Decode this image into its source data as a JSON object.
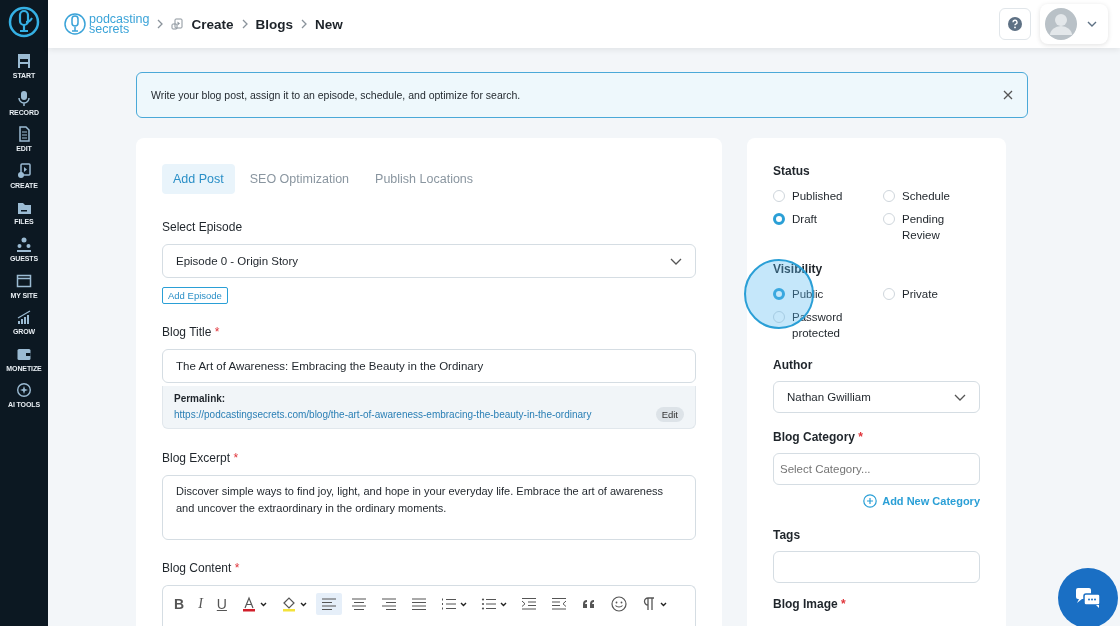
{
  "sidebar": {
    "items": [
      {
        "label": "START"
      },
      {
        "label": "RECORD"
      },
      {
        "label": "EDIT"
      },
      {
        "label": "CREATE"
      },
      {
        "label": "FILES"
      },
      {
        "label": "GUESTS"
      },
      {
        "label": "MY SITE"
      },
      {
        "label": "GROW"
      },
      {
        "label": "MONETIZE"
      },
      {
        "label": "AI TOOLS"
      }
    ]
  },
  "logo": {
    "line1": "podcasting",
    "line2": "secrets"
  },
  "breadcrumb": [
    "Create",
    "Blogs",
    "New"
  ],
  "notice": {
    "text": "Write your blog post, assign it to an episode, schedule, and optimize for search."
  },
  "tabs": [
    {
      "label": "Add Post",
      "selected": true
    },
    {
      "label": "SEO Optimization",
      "selected": false
    },
    {
      "label": "Publish Locations",
      "selected": false
    }
  ],
  "episode": {
    "label": "Select Episode",
    "value": "Episode 0 - Origin Story",
    "add_button": "Add Episode"
  },
  "blog_title": {
    "label": "Blog Title",
    "required_mark": "*",
    "value": "The Art of Awareness: Embracing the Beauty in the Ordinary"
  },
  "permalink": {
    "label": "Permalink:",
    "url": "https://podcastingsecrets.com/blog/the-art-of-awareness-embracing-the-beauty-in-the-ordinary",
    "edit": "Edit"
  },
  "excerpt": {
    "label": "Blog Excerpt",
    "required_mark": "*",
    "value": "Discover simple ways to find joy, light, and hope in your everyday life. Embrace the art of awareness and uncover the extraordinary in the ordinary moments."
  },
  "content": {
    "label": "Blog Content",
    "required_mark": "*",
    "toolbar": [
      {
        "kind": "bold",
        "label": "B",
        "active": false,
        "dropdown": false
      },
      {
        "kind": "italic",
        "label": "I",
        "active": false,
        "dropdown": false
      },
      {
        "kind": "underline",
        "label": "U",
        "active": false,
        "dropdown": false
      },
      {
        "kind": "font-color",
        "active": false,
        "dropdown": true
      },
      {
        "kind": "highlight",
        "active": false,
        "dropdown": true
      },
      {
        "kind": "align-left",
        "active": true,
        "dropdown": false
      },
      {
        "kind": "align-center",
        "active": false,
        "dropdown": false
      },
      {
        "kind": "align-right",
        "active": false,
        "dropdown": false
      },
      {
        "kind": "justify",
        "active": false,
        "dropdown": false
      },
      {
        "kind": "ordered-list",
        "active": false,
        "dropdown": true
      },
      {
        "kind": "bullet-list",
        "active": false,
        "dropdown": true
      },
      {
        "kind": "indent",
        "active": false,
        "dropdown": false
      },
      {
        "kind": "outdent",
        "active": false,
        "dropdown": false
      },
      {
        "kind": "quote",
        "active": false,
        "dropdown": false
      },
      {
        "kind": "emoji",
        "active": false,
        "dropdown": false
      },
      {
        "kind": "paragraph",
        "active": false,
        "dropdown": true
      }
    ]
  },
  "status": {
    "label": "Status",
    "options": [
      {
        "label": "Published",
        "selected": false
      },
      {
        "label": "Schedule",
        "selected": false
      },
      {
        "label": "Draft",
        "selected": true
      },
      {
        "label": "Pending Review",
        "selected": false
      }
    ]
  },
  "visibility": {
    "label": "Visibility",
    "options": [
      {
        "label": "Public",
        "selected": true
      },
      {
        "label": "Private",
        "selected": false
      },
      {
        "label": "Password protected",
        "selected": false
      }
    ]
  },
  "author": {
    "label": "Author",
    "value": "Nathan Gwilliam"
  },
  "category": {
    "label": "Blog Category",
    "required_mark": "*",
    "placeholder": "Select Category...",
    "add_link": "Add New Category"
  },
  "tags": {
    "label": "Tags"
  },
  "blog_image": {
    "label": "Blog Image",
    "required_mark": "*"
  }
}
